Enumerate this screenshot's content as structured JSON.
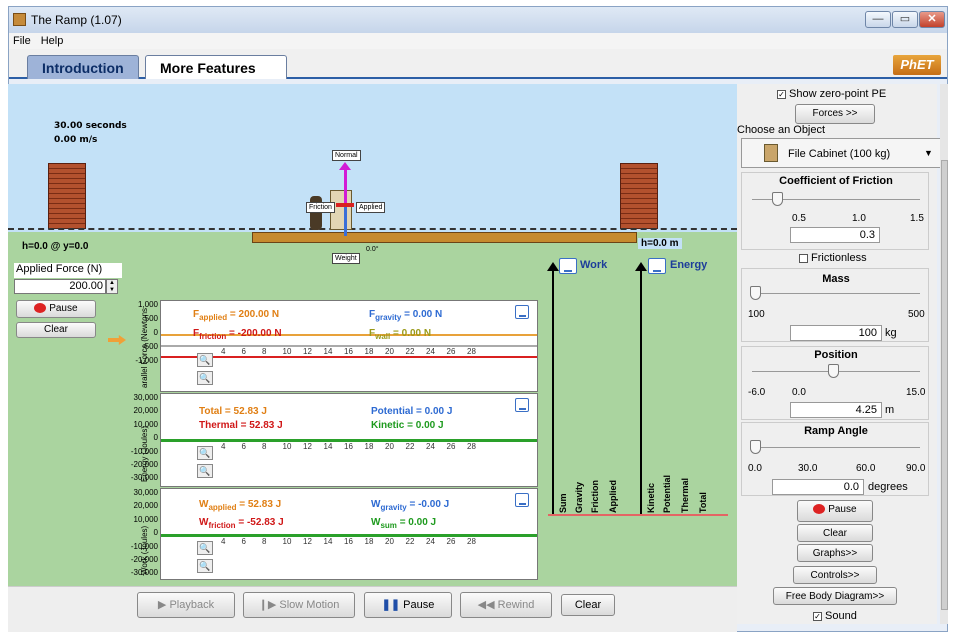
{
  "window": {
    "title": "The Ramp (1.07)"
  },
  "menu": [
    "File",
    "Help"
  ],
  "tabs": [
    {
      "label": "Introduction"
    },
    {
      "label": "More Features"
    }
  ],
  "logo": "PhET",
  "scene": {
    "time": "30.00 seconds",
    "speed": "0.00 m/s",
    "h_left": "h=0.0 @ y=0.0",
    "h_right": "h=0.0 m",
    "force_labels": {
      "normal": "Normal",
      "friction": "Friction",
      "applied": "Applied",
      "weight": "Weight"
    },
    "angle_label": "0.0°"
  },
  "applied_force": {
    "label": "Applied Force (N)",
    "value": "200.00"
  },
  "left_buttons": {
    "pause": "Pause",
    "clear": "Clear"
  },
  "bar_charts": {
    "work_title": "Work",
    "energy_title": "Energy",
    "work_bars": [
      "Sum",
      "Gravity",
      "Friction",
      "Applied"
    ],
    "energy_bars": [
      "Kinetic",
      "Potential",
      "Thermal",
      "Total"
    ]
  },
  "graphs": {
    "x_ticks": [
      "4",
      "6",
      "8",
      "10",
      "12",
      "14",
      "16",
      "18",
      "20",
      "22",
      "24",
      "26",
      "28"
    ],
    "force": {
      "ylabel": "arallel Force (Newtons",
      "yticks": [
        "1,000",
        "500",
        "0",
        "-500",
        "-1,000"
      ],
      "applied": "F",
      "applied_sub": "applied",
      "applied_val": "= 200.00 N",
      "friction": "F",
      "friction_sub": "friction",
      "friction_val": "= -200.00 N",
      "gravity": "F",
      "gravity_sub": "gravity",
      "gravity_val": "= 0.00 N",
      "wall": "F",
      "wall_sub": "wall",
      "wall_val": "= 0.00 N"
    },
    "energy": {
      "ylabel": "Energy (Joules)",
      "yticks": [
        "30,000",
        "20,000",
        "10,000",
        "0",
        "-10,000",
        "-20,000",
        "-30,000"
      ],
      "total": "Total = 52.83 J",
      "thermal": "Thermal = 52.83 J",
      "potential": "Potential = 0.00 J",
      "kinetic": "Kinetic = 0.00 J"
    },
    "work": {
      "ylabel": "Work (Joules)",
      "yticks": [
        "30,000",
        "20,000",
        "10,000",
        "0",
        "-10,000",
        "-20,000",
        "-30,000"
      ],
      "applied": "W",
      "applied_sub": "applied",
      "applied_val": "= 52.83 J",
      "friction": "W",
      "friction_sub": "friction",
      "friction_val": "= -52.83 J",
      "gravity": "W",
      "gravity_sub": "gravity",
      "gravity_val": "= -0.00 J",
      "sum": "W",
      "sum_sub": "sum",
      "sum_val": "= 0.00 J"
    }
  },
  "playback": {
    "playback": "Playback",
    "slow": "Slow Motion",
    "pause": "Pause",
    "rewind": "Rewind",
    "clear": "Clear"
  },
  "controls": {
    "show_zero_pe": "Show zero-point PE",
    "forces_btn": "Forces >>",
    "choose_object": "Choose an Object",
    "object": "File Cabinet (100 kg)",
    "friction_title": "Coefficient of Friction",
    "friction_ticks": [
      "0.5",
      "1.0",
      "1.5"
    ],
    "friction_val": "0.3",
    "frictionless": "Frictionless",
    "mass_title": "Mass",
    "mass_ticks": [
      "100",
      "500"
    ],
    "mass_val": "100",
    "mass_unit": "kg",
    "pos_title": "Position",
    "pos_ticks": [
      "-6.0",
      "0.0",
      "15.0"
    ],
    "pos_val": "4.25",
    "pos_unit": "m",
    "angle_title": "Ramp Angle",
    "angle_ticks": [
      "0.0",
      "30.0",
      "60.0",
      "90.0"
    ],
    "angle_val": "0.0",
    "angle_unit": "degrees",
    "pause": "Pause",
    "clear": "Clear",
    "graphs": "Graphs>>",
    "controls": "Controls>>",
    "fbd": "Free Body Diagram>>",
    "sound": "Sound"
  }
}
